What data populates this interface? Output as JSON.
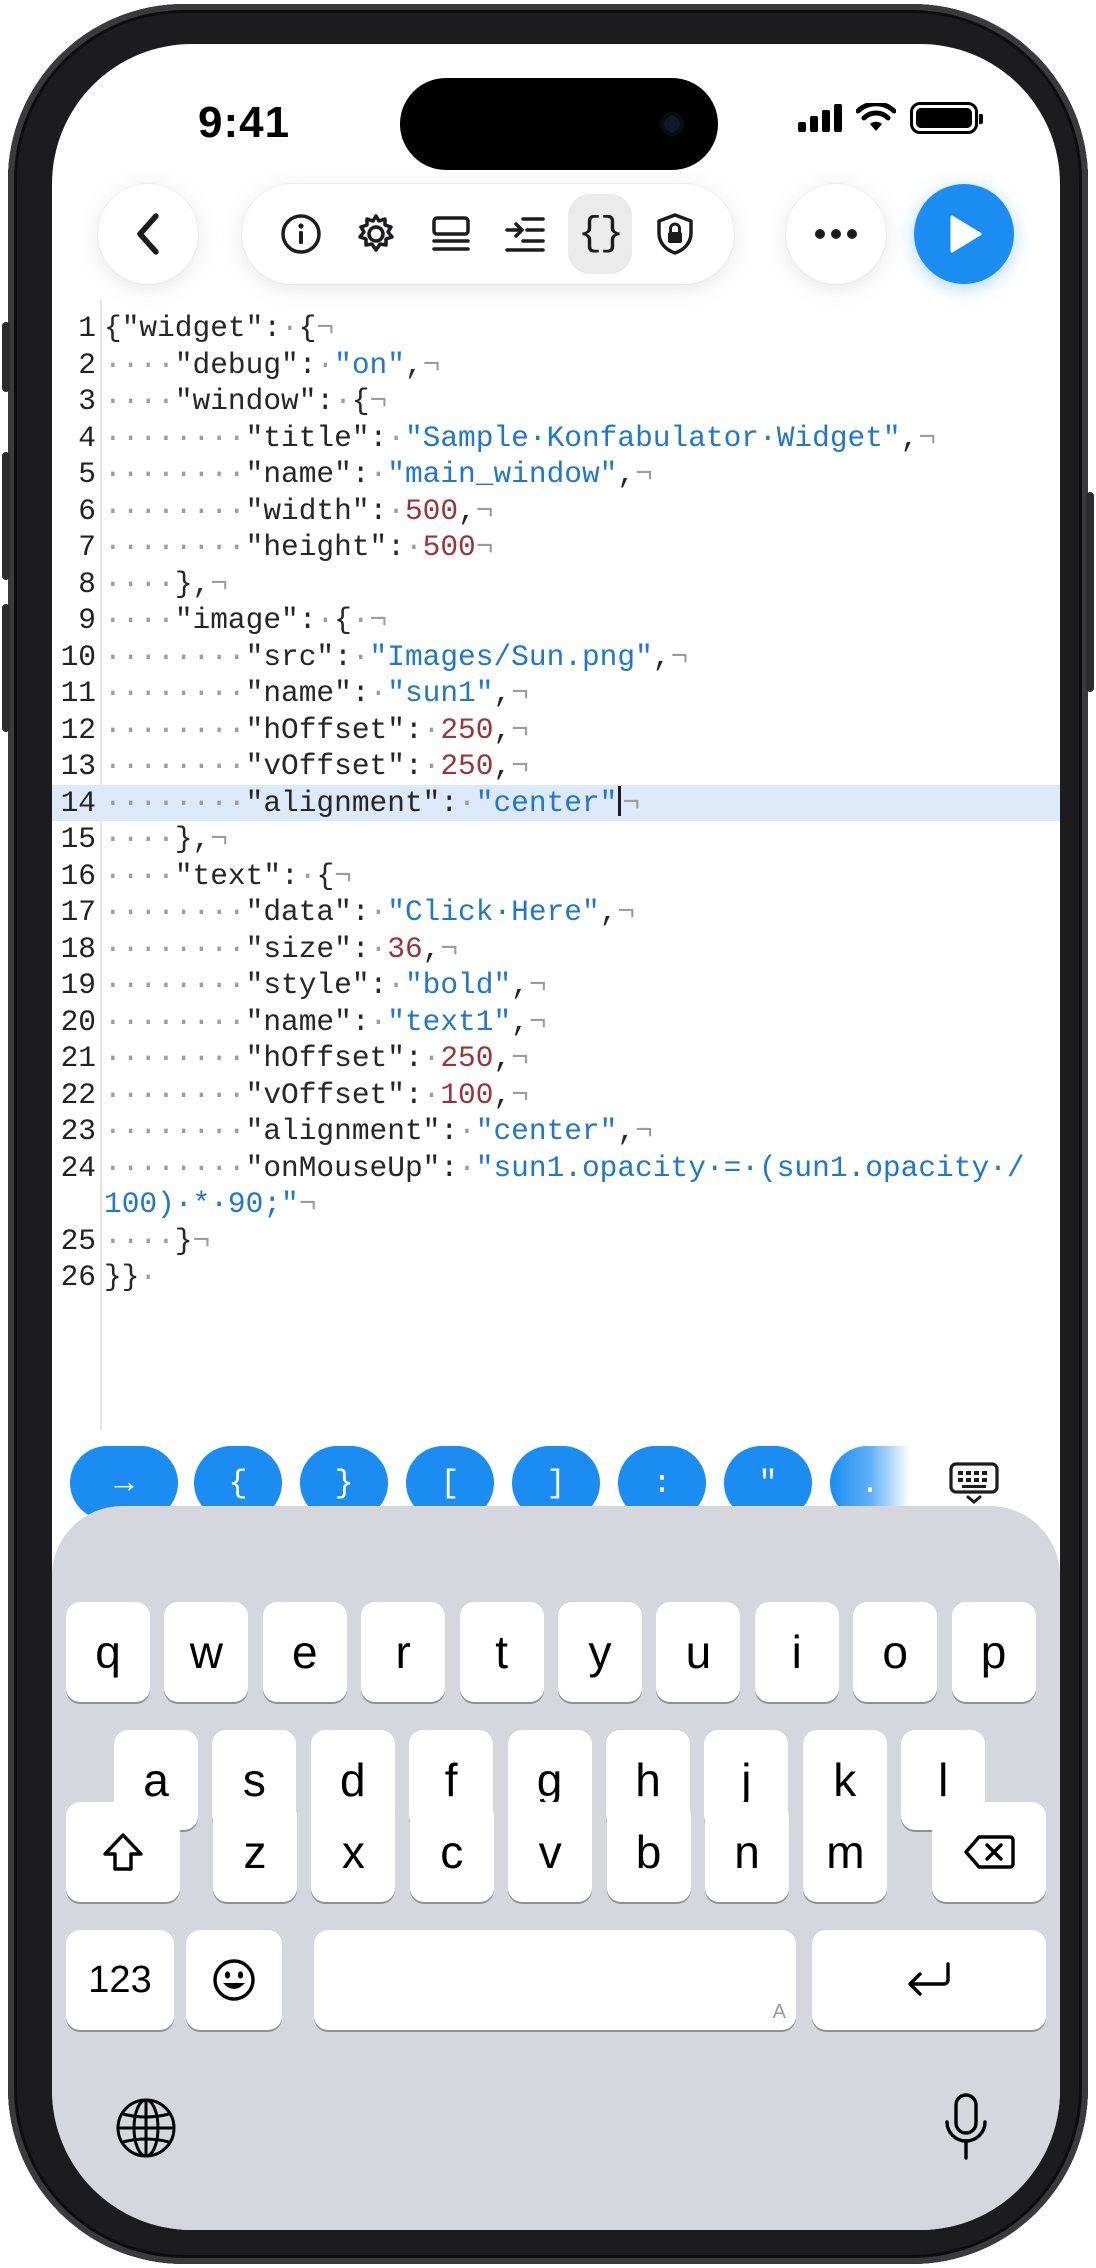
{
  "status_bar": {
    "time": "9:41"
  },
  "toolbar": {
    "back_icon": "chevron-left-icon",
    "tools": [
      {
        "name": "info-icon",
        "active": false
      },
      {
        "name": "gear-icon",
        "active": false
      },
      {
        "name": "layout-icon",
        "active": false
      },
      {
        "name": "format-indent-icon",
        "active": false
      },
      {
        "name": "braces-icon",
        "active": true,
        "glyph": "{}"
      },
      {
        "name": "shield-lock-icon",
        "active": false
      }
    ],
    "more_icon": "ellipsis-icon",
    "run_icon": "play-icon",
    "accent_color": "#1a8cf2"
  },
  "editor": {
    "active_line": 14,
    "lines": [
      {
        "n": "1"
      },
      {
        "n": "2"
      },
      {
        "n": "3"
      },
      {
        "n": "4"
      },
      {
        "n": "5"
      },
      {
        "n": "6"
      },
      {
        "n": "7"
      },
      {
        "n": "8"
      },
      {
        "n": "9"
      },
      {
        "n": "10"
      },
      {
        "n": "11"
      },
      {
        "n": "12"
      },
      {
        "n": "13"
      },
      {
        "n": "14"
      },
      {
        "n": "15"
      },
      {
        "n": "16"
      },
      {
        "n": "17"
      },
      {
        "n": "18"
      },
      {
        "n": "19"
      },
      {
        "n": "20"
      },
      {
        "n": "21"
      },
      {
        "n": "22"
      },
      {
        "n": "23"
      },
      {
        "n": "24"
      },
      {
        "n": ""
      },
      {
        "n": "25"
      },
      {
        "n": "26"
      }
    ],
    "content": [
      [
        [
          "k",
          "{\"widget\":"
        ],
        [
          "i",
          "·"
        ],
        [
          "k",
          "{"
        ],
        [
          "i",
          "¬"
        ]
      ],
      [
        [
          "i",
          "····"
        ],
        [
          "k",
          "\"debug\":"
        ],
        [
          "i",
          "·"
        ],
        [
          "s",
          "\"on\""
        ],
        [
          "k",
          ","
        ],
        [
          "i",
          "¬"
        ]
      ],
      [
        [
          "i",
          "····"
        ],
        [
          "k",
          "\"window\":"
        ],
        [
          "i",
          "·"
        ],
        [
          "k",
          "{"
        ],
        [
          "i",
          "¬"
        ]
      ],
      [
        [
          "i",
          "········"
        ],
        [
          "k",
          "\"title\":"
        ],
        [
          "i",
          "·"
        ],
        [
          "s",
          "\"Sample·Konfabulator·Widget\""
        ],
        [
          "k",
          ","
        ],
        [
          "i",
          "¬"
        ]
      ],
      [
        [
          "i",
          "········"
        ],
        [
          "k",
          "\"name\":"
        ],
        [
          "i",
          "·"
        ],
        [
          "s",
          "\"main_window\""
        ],
        [
          "k",
          ","
        ],
        [
          "i",
          "¬"
        ]
      ],
      [
        [
          "i",
          "········"
        ],
        [
          "k",
          "\"width\":"
        ],
        [
          "i",
          "·"
        ],
        [
          "n",
          "500"
        ],
        [
          "k",
          ","
        ],
        [
          "i",
          "¬"
        ]
      ],
      [
        [
          "i",
          "········"
        ],
        [
          "k",
          "\"height\":"
        ],
        [
          "i",
          "·"
        ],
        [
          "n",
          "500"
        ],
        [
          "i",
          "¬"
        ]
      ],
      [
        [
          "i",
          "····"
        ],
        [
          "k",
          "},"
        ],
        [
          "i",
          "¬"
        ]
      ],
      [
        [
          "i",
          "····"
        ],
        [
          "k",
          "\"image\":"
        ],
        [
          "i",
          "·"
        ],
        [
          "k",
          "{"
        ],
        [
          "i",
          "·¬"
        ]
      ],
      [
        [
          "i",
          "········"
        ],
        [
          "k",
          "\"src\":"
        ],
        [
          "i",
          "·"
        ],
        [
          "s",
          "\"Images/Sun.png\""
        ],
        [
          "k",
          ","
        ],
        [
          "i",
          "¬"
        ]
      ],
      [
        [
          "i",
          "········"
        ],
        [
          "k",
          "\"name\":"
        ],
        [
          "i",
          "·"
        ],
        [
          "s",
          "\"sun1\""
        ],
        [
          "k",
          ","
        ],
        [
          "i",
          "¬"
        ]
      ],
      [
        [
          "i",
          "········"
        ],
        [
          "k",
          "\"hOffset\":"
        ],
        [
          "i",
          "·"
        ],
        [
          "n",
          "250"
        ],
        [
          "k",
          ","
        ],
        [
          "i",
          "¬"
        ]
      ],
      [
        [
          "i",
          "········"
        ],
        [
          "k",
          "\"vOffset\":"
        ],
        [
          "i",
          "·"
        ],
        [
          "n",
          "250"
        ],
        [
          "k",
          ","
        ],
        [
          "i",
          "¬"
        ]
      ],
      [
        [
          "i",
          "········"
        ],
        [
          "k",
          "\"alignment\":"
        ],
        [
          "i",
          "·"
        ],
        [
          "s",
          "\"center\""
        ],
        [
          "c",
          ""
        ],
        [
          "i",
          "¬"
        ]
      ],
      [
        [
          "i",
          "····"
        ],
        [
          "k",
          "},"
        ],
        [
          "i",
          "¬"
        ]
      ],
      [
        [
          "i",
          "····"
        ],
        [
          "k",
          "\"text\":"
        ],
        [
          "i",
          "·"
        ],
        [
          "k",
          "{"
        ],
        [
          "i",
          "¬"
        ]
      ],
      [
        [
          "i",
          "········"
        ],
        [
          "k",
          "\"data\":"
        ],
        [
          "i",
          "·"
        ],
        [
          "s",
          "\"Click·Here\""
        ],
        [
          "k",
          ","
        ],
        [
          "i",
          "¬"
        ]
      ],
      [
        [
          "i",
          "········"
        ],
        [
          "k",
          "\"size\":"
        ],
        [
          "i",
          "·"
        ],
        [
          "n",
          "36"
        ],
        [
          "k",
          ","
        ],
        [
          "i",
          "¬"
        ]
      ],
      [
        [
          "i",
          "········"
        ],
        [
          "k",
          "\"style\":"
        ],
        [
          "i",
          "·"
        ],
        [
          "s",
          "\"bold\""
        ],
        [
          "k",
          ","
        ],
        [
          "i",
          "¬"
        ]
      ],
      [
        [
          "i",
          "········"
        ],
        [
          "k",
          "\"name\":"
        ],
        [
          "i",
          "·"
        ],
        [
          "s",
          "\"text1\""
        ],
        [
          "k",
          ","
        ],
        [
          "i",
          "¬"
        ]
      ],
      [
        [
          "i",
          "········"
        ],
        [
          "k",
          "\"hOffset\":"
        ],
        [
          "i",
          "·"
        ],
        [
          "n",
          "250"
        ],
        [
          "k",
          ","
        ],
        [
          "i",
          "¬"
        ]
      ],
      [
        [
          "i",
          "········"
        ],
        [
          "k",
          "\"vOffset\":"
        ],
        [
          "i",
          "·"
        ],
        [
          "n",
          "100"
        ],
        [
          "k",
          ","
        ],
        [
          "i",
          "¬"
        ]
      ],
      [
        [
          "i",
          "········"
        ],
        [
          "k",
          "\"alignment\":"
        ],
        [
          "i",
          "·"
        ],
        [
          "s",
          "\"center\""
        ],
        [
          "k",
          ","
        ],
        [
          "i",
          "¬"
        ]
      ],
      [
        [
          "i",
          "········"
        ],
        [
          "k",
          "\"onMouseUp\":"
        ],
        [
          "i",
          "·"
        ],
        [
          "s",
          "\"sun1.opacity·=·(sun1.opacity·/"
        ]
      ],
      [
        [
          "s",
          "100)·*·90;\""
        ],
        [
          "i",
          "¬"
        ]
      ],
      [
        [
          "i",
          "····"
        ],
        [
          "k",
          "}"
        ],
        [
          "i",
          "¬"
        ]
      ],
      [
        [
          "k",
          "}}"
        ],
        [
          "i",
          "·"
        ]
      ]
    ]
  },
  "accessory_bar": {
    "keys": [
      "→",
      "{",
      "}",
      "[",
      "]",
      ":",
      "\"",
      "."
    ],
    "dismiss_icon": "keyboard-dismiss-icon"
  },
  "keyboard": {
    "row1": [
      "q",
      "w",
      "e",
      "r",
      "t",
      "y",
      "u",
      "i",
      "o",
      "p"
    ],
    "row2": [
      "a",
      "s",
      "d",
      "f",
      "g",
      "h",
      "j",
      "k",
      "l"
    ],
    "row3": [
      "z",
      "x",
      "c",
      "v",
      "b",
      "n",
      "m"
    ],
    "numbers_label": "123",
    "space_hint": "A",
    "icons": [
      "shift-icon",
      "backspace-icon",
      "emoji-icon",
      "return-icon",
      "globe-icon",
      "microphone-icon"
    ]
  }
}
